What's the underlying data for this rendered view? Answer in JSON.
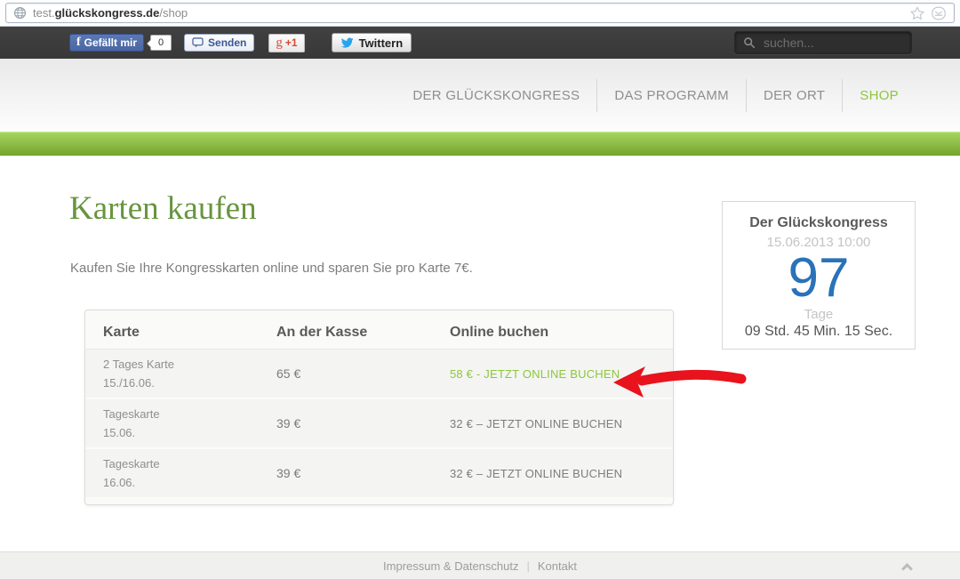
{
  "browser": {
    "url": {
      "prefix": "test.",
      "domain": "glückskongress.de",
      "path": "/shop"
    }
  },
  "social_bar": {
    "facebook_f": "f",
    "facebook_like_label": "Gefällt mir",
    "like_count": "0",
    "send_label": "Senden",
    "gplus_g": "g",
    "gplus_label": "+1",
    "twitter_label": "Twittern",
    "search_placeholder": "suchen..."
  },
  "nav": {
    "items": [
      {
        "label": "DER GLÜCKSKONGRESS",
        "active": false
      },
      {
        "label": "DAS PROGRAMM",
        "active": false
      },
      {
        "label": "DER ORT",
        "active": false
      },
      {
        "label": "SHOP",
        "active": true
      }
    ]
  },
  "main": {
    "title": "Karten kaufen",
    "intro": "Kaufen Sie Ihre Kongresskarten online und sparen Sie pro Karte 7€.",
    "table": {
      "headers": [
        "Karte",
        "An der Kasse",
        "Online buchen"
      ],
      "rows": [
        {
          "name": "2 Tages Karte",
          "date": "15./16.06.",
          "kasse": "65 €",
          "online": "58 € - JETZT ONLINE BUCHEN",
          "highlight": true
        },
        {
          "name": "Tageskarte",
          "date": "15.06.",
          "kasse": "39 €",
          "online": "32 € – JETZT ONLINE BUCHEN",
          "highlight": false
        },
        {
          "name": "Tageskarte",
          "date": "16.06.",
          "kasse": "39 €",
          "online": "32 € – JETZT ONLINE BUCHEN",
          "highlight": false
        }
      ]
    },
    "countdown": {
      "title": "Der Glückskongress",
      "datetime": "15.06.2013 10:00",
      "days": "97",
      "days_label": "Tage",
      "time_left": "09 Std. 45 Min. 15 Sec."
    }
  },
  "footer": {
    "impressum": "Impressum & Datenschutz",
    "separator": "|",
    "kontakt": "Kontakt"
  },
  "icons": {
    "globe": "globe-icon",
    "star": "bookmark-star-icon",
    "envelope": "envelope-icon",
    "speech_bubble": "speech-bubble-icon",
    "twitter_bird": "twitter-bird-icon",
    "magnifier": "search-icon",
    "red_arrow": "red-arrow-annotation",
    "chevron_up": "scroll-top-chevron-icon"
  },
  "colors": {
    "accent_green": "#8dc63f",
    "heading_green": "#67953e",
    "countdown_blue": "#2a72b9",
    "arrow_red": "#e8131c",
    "facebook_blue": "#4a67a3",
    "toolbar_dark": "#3c3c3c"
  }
}
